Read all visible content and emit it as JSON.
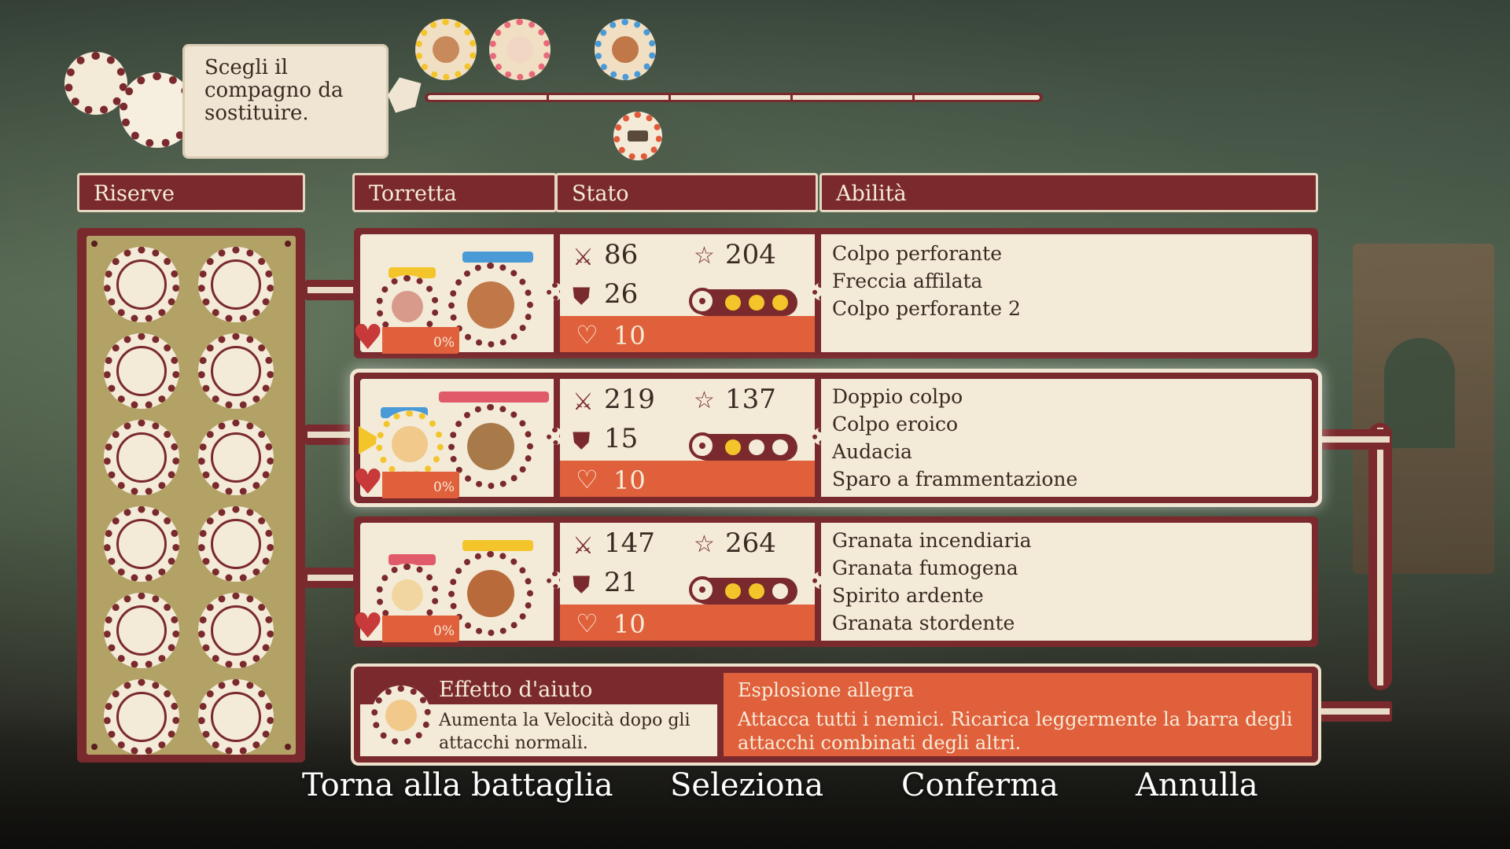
{
  "prompt": {
    "text": "Scegli il compagno da sostituire."
  },
  "headers": {
    "reserves": "Riserve",
    "turret": "Torretta",
    "status": "Stato",
    "abilities": "Abilità"
  },
  "rows": [
    {
      "attack": "86",
      "speed": "204",
      "defense": "26",
      "hp": "10",
      "charge_filled": 3,
      "charge_total": 3,
      "percent": "0%",
      "abilities": [
        "Colpo perforante",
        "Freccia affilata",
        "Colpo perforante 2"
      ],
      "active": false
    },
    {
      "attack": "219",
      "speed": "137",
      "defense": "15",
      "hp": "10",
      "charge_filled": 1,
      "charge_total": 3,
      "percent": "0%",
      "abilities": [
        "Doppio colpo",
        "Colpo eroico",
        "Audacia",
        "Sparo a frammentazione"
      ],
      "active": true
    },
    {
      "attack": "147",
      "speed": "264",
      "defense": "21",
      "hp": "10",
      "charge_filled": 2,
      "charge_total": 3,
      "percent": "0%",
      "abilities": [
        "Granata incendiaria",
        "Granata fumogena",
        "Spirito ardente",
        "Granata stordente"
      ],
      "active": false
    }
  ],
  "support": {
    "title": "Effetto d'aiuto",
    "desc": "Aumenta la Velocità dopo gli attacchi normali.",
    "skill_title": "Esplosione allegra",
    "skill_desc": "Attacca tutti i nemici. Ricarica leggermente la barra degli attacchi combinati degli altri."
  },
  "buttons": {
    "back": "Torna alla battaglia",
    "select": "Seleziona",
    "confirm": "Conferma",
    "cancel": "Annulla"
  },
  "icons": {
    "attack": "sword-icon",
    "speed": "star-icon",
    "defense": "shield-icon",
    "hp": "heart-icon",
    "charge": "target-icon"
  },
  "colors": {
    "primary": "#7a2a2d",
    "panel": "#f3ead8",
    "accent": "#e0603c",
    "gold": "#f3c52a",
    "reserve_bg": "#b3a266"
  }
}
